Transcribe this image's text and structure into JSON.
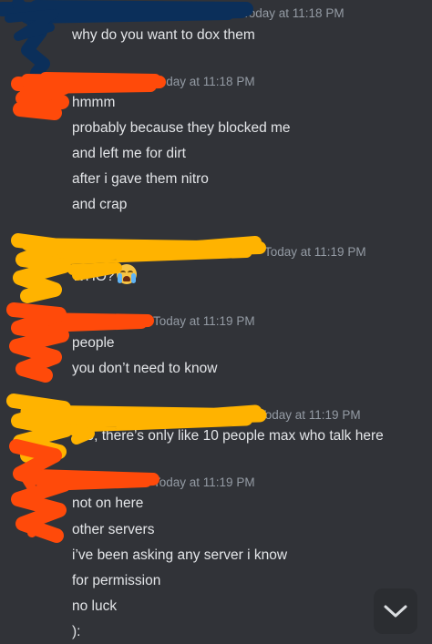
{
  "messages": [
    {
      "timestamp": "Today at 11:18 PM",
      "lines": [
        "why do you want to dox them"
      ]
    },
    {
      "timestamp": "Today at 11:18 PM",
      "lines": [
        "hmmm",
        "probably because they blocked me",
        "and left me for dirt",
        "after i gave them nitro",
        "and crap"
      ]
    },
    {
      "timestamp": "Today at 11:19 PM",
      "lines": [
        "WHO?"
      ],
      "emoji": "loudly-crying-face"
    },
    {
      "timestamp": "Today at 11:19 PM",
      "lines": [
        "people",
        "you don’t need to know"
      ]
    },
    {
      "timestamp": "Today at 11:19 PM",
      "lines": [
        "Bro, there’s only like 10 people max who talk here"
      ]
    },
    {
      "timestamp": "Today at 11:19 PM",
      "lines": [
        "not on here",
        "other servers",
        "i’ve been asking any server i know",
        "for permission",
        "no luck",
        "):"
      ]
    }
  ],
  "scroll_button": {
    "icon": "chevron-down-icon"
  },
  "colors": {
    "background": "#313338",
    "text": "#e3e5e8",
    "timestamp": "#949ba4",
    "scribble_blue": "#0b2f5a",
    "scribble_orange": "#ff4a0a",
    "scribble_yellow": "#ffb300"
  }
}
